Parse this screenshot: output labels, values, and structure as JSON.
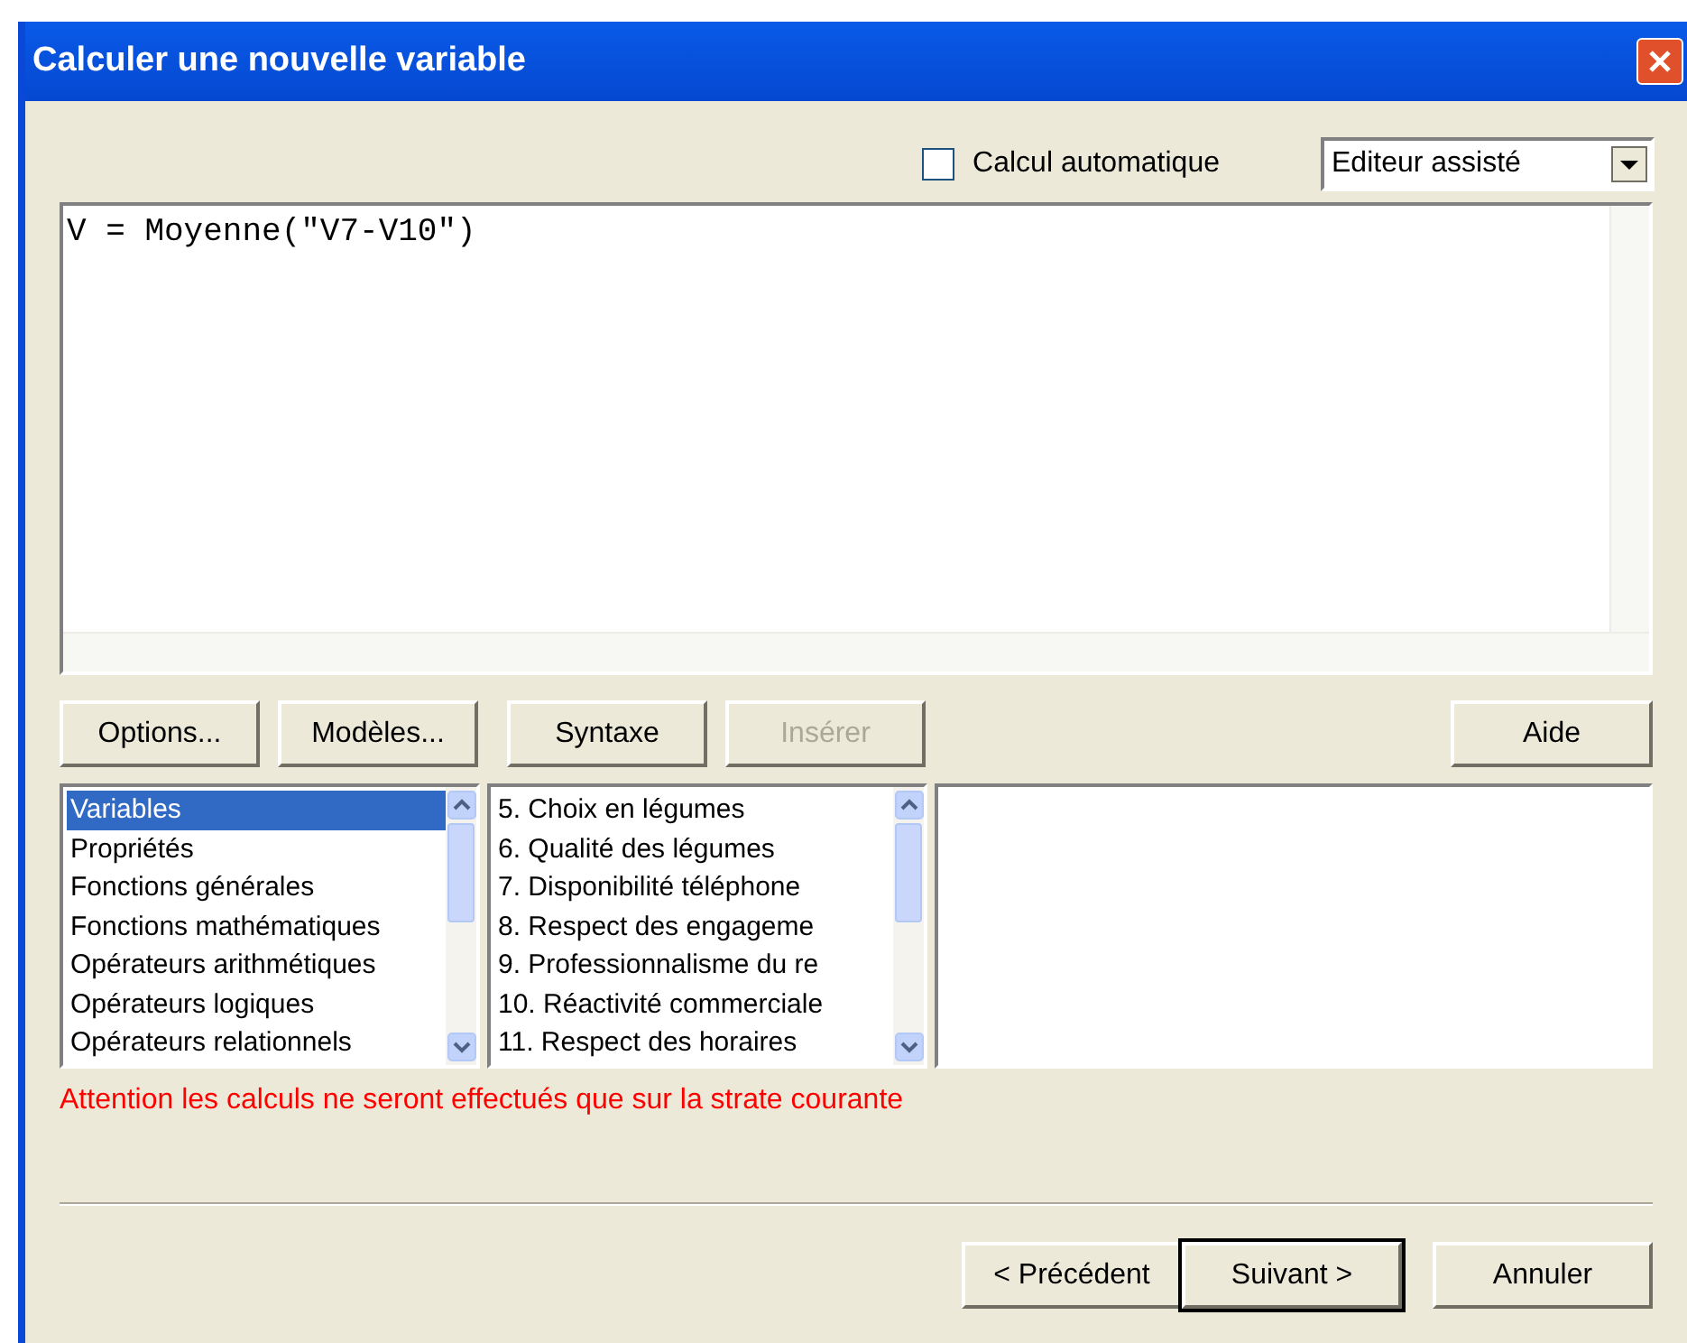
{
  "window": {
    "title": "Calculer une nouvelle variable"
  },
  "auto_calc": {
    "label": "Calcul automatique",
    "checked": false
  },
  "editor_mode": {
    "value": "Editeur assisté"
  },
  "editor": {
    "value": "V = Moyenne(\"V7-V10\")"
  },
  "tool_buttons": [
    {
      "label": "Options...",
      "disabled": false
    },
    {
      "label": "Modèles...",
      "disabled": false
    },
    {
      "label": "Syntaxe",
      "disabled": false
    },
    {
      "label": "Insérer",
      "disabled": true
    }
  ],
  "help_button": {
    "label": "Aide"
  },
  "categories": [
    {
      "label": "Variables",
      "selected": true
    },
    {
      "label": "Propriétés",
      "selected": false
    },
    {
      "label": "Fonctions générales",
      "selected": false
    },
    {
      "label": "Fonctions mathématiques",
      "selected": false
    },
    {
      "label": "Opérateurs arithmétiques",
      "selected": false
    },
    {
      "label": "Opérateurs logiques",
      "selected": false
    },
    {
      "label": "Opérateurs relationnels",
      "selected": false
    }
  ],
  "variables": [
    {
      "label": "5. Choix en légumes",
      "selected": false
    },
    {
      "label": "6. Qualité des légumes",
      "selected": false
    },
    {
      "label": "7. Disponibilité téléphone",
      "selected": false
    },
    {
      "label": "8. Respect des engageme",
      "selected": false
    },
    {
      "label": "9. Professionnalisme du re",
      "selected": false
    },
    {
      "label": "10. Réactivité commerciale",
      "selected": false
    },
    {
      "label": "11. Respect des horaires",
      "selected": false
    }
  ],
  "warning": "Attention les calculs ne seront effectués que sur la strate courante",
  "footer_buttons": [
    {
      "label": "< Précédent",
      "default": false
    },
    {
      "label": "Suivant >",
      "default": true
    },
    {
      "label": "Annuler",
      "default": false
    }
  ]
}
